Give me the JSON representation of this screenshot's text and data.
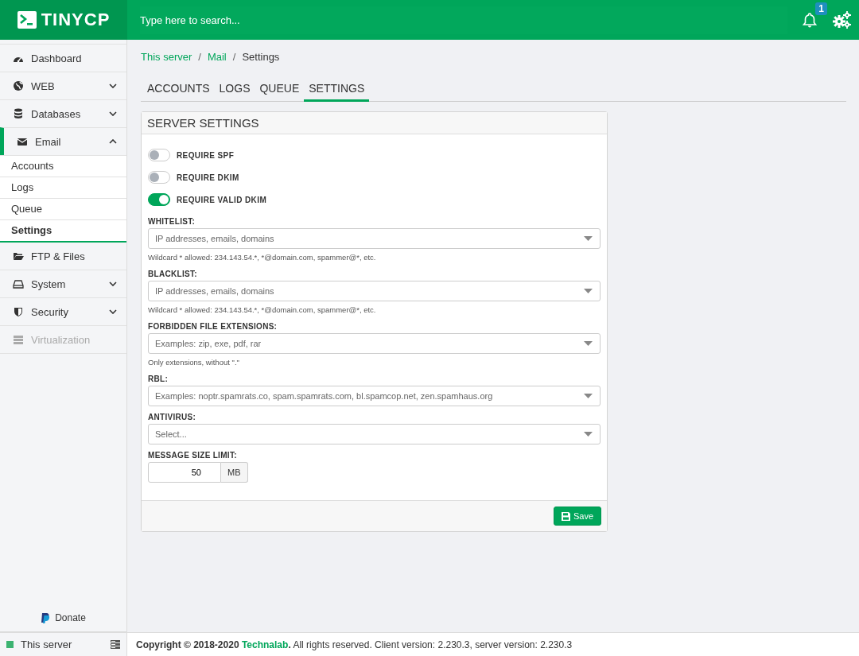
{
  "header": {
    "logo": "TINYCP",
    "search": {
      "placeholder": "Type here to search..."
    },
    "notifications": {
      "count": "1"
    }
  },
  "sidebar": {
    "items": [
      {
        "label": "Dashboard",
        "kind": "link",
        "selected": false,
        "disabled": false
      },
      {
        "label": "WEB",
        "kind": "group",
        "selected": false,
        "disabled": false,
        "expanded": false
      },
      {
        "label": "Databases",
        "kind": "group",
        "selected": false,
        "disabled": false,
        "expanded": false
      },
      {
        "label": "Email",
        "kind": "group",
        "selected": true,
        "disabled": false,
        "expanded": true,
        "children": [
          {
            "label": "Accounts",
            "selected": false
          },
          {
            "label": "Logs",
            "selected": false
          },
          {
            "label": "Queue",
            "selected": false
          },
          {
            "label": "Settings",
            "selected": true
          }
        ]
      },
      {
        "label": "FTP & Files",
        "kind": "link",
        "selected": false,
        "disabled": false
      },
      {
        "label": "System",
        "kind": "group",
        "selected": false,
        "disabled": false,
        "expanded": false
      },
      {
        "label": "Security",
        "kind": "group",
        "selected": false,
        "disabled": false,
        "expanded": false
      },
      {
        "label": "Virtualization",
        "kind": "link",
        "selected": false,
        "disabled": true
      }
    ],
    "donate": "Donate",
    "server": "This server"
  },
  "breadcrumb": {
    "separator": "/",
    "items": [
      {
        "label": "This server",
        "kind": "link"
      },
      {
        "label": "Mail",
        "kind": "link"
      },
      {
        "label": "Settings",
        "kind": "current"
      }
    ]
  },
  "tabs": [
    {
      "label": "ACCOUNTS",
      "selected": false
    },
    {
      "label": "LOGS",
      "selected": false
    },
    {
      "label": "QUEUE",
      "selected": false
    },
    {
      "label": "SETTINGS",
      "selected": true
    }
  ],
  "panel": {
    "title": "SERVER SETTINGS",
    "toggles": [
      {
        "label": "REQUIRE SPF",
        "on": false
      },
      {
        "label": "REQUIRE DKIM",
        "on": false
      },
      {
        "label": "REQUIRE VALID DKIM",
        "on": true
      }
    ],
    "fields": [
      {
        "label": "WHITELIST:",
        "placeholder": "IP addresses, emails, domains",
        "help": "Wildcard * allowed: 234.143.54.*, *@domain.com, spammer@*, etc."
      },
      {
        "label": "BLACKLIST:",
        "placeholder": "IP addresses, emails, domains",
        "help": "Wildcard * allowed: 234.143.54.*, *@domain.com, spammer@*, etc."
      },
      {
        "label": "FORBIDDEN FILE EXTENSIONS:",
        "placeholder": "Examples: zip, exe, pdf, rar",
        "help": "Only extensions, without \".\""
      },
      {
        "label": "RBL:",
        "placeholder": "Examples: noptr.spamrats.co, spam.spamrats.com, bl.spamcop.net, zen.spamhaus.org"
      },
      {
        "label": "ANTIVIRUS:",
        "placeholder": "Select..."
      }
    ],
    "size": {
      "label": "MESSAGE SIZE LIMIT:",
      "value": "50",
      "unit": "MB"
    },
    "save": "Save"
  },
  "footer": {
    "prefix": "**Copyright © 2018-2020** ",
    "link": "Technalab",
    "suffix": "**.** All rights reserved. Client version: 2.230.3, server version: 2.230.3"
  }
}
